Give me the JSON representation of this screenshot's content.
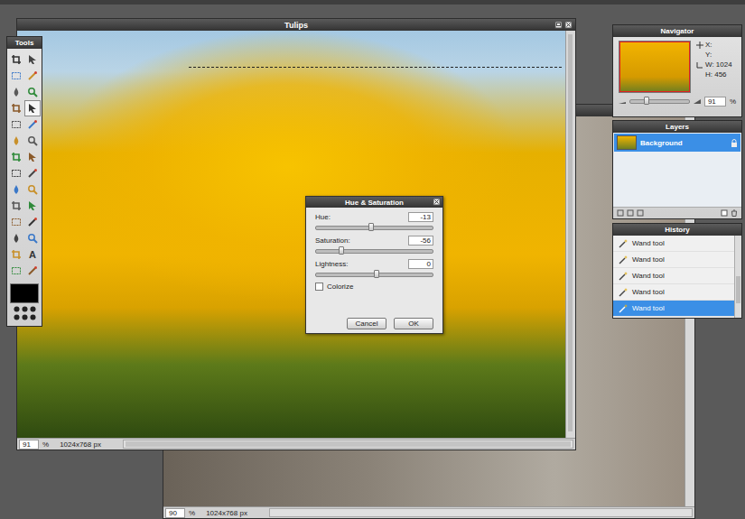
{
  "tulips_window": {
    "title": "Tulips",
    "zoom": "91",
    "zoom_unit": "%",
    "size": "1024x768 px"
  },
  "back_window": {
    "zoom": "90",
    "zoom_unit": "%",
    "size": "1024x768 px"
  },
  "tools": {
    "title": "Tools",
    "items": [
      {
        "kind": "icon",
        "label": "",
        "selected": false
      },
      {
        "kind": "icon",
        "label": "",
        "selected": false
      },
      {
        "kind": "icon",
        "label": "",
        "selected": false
      },
      {
        "kind": "icon",
        "label": "",
        "selected": false
      },
      {
        "kind": "icon",
        "label": "",
        "selected": false
      },
      {
        "kind": "icon",
        "label": "",
        "selected": false
      },
      {
        "kind": "icon",
        "label": "",
        "selected": false
      },
      {
        "kind": "icon",
        "label": "",
        "selected": true
      },
      {
        "kind": "icon",
        "label": "",
        "selected": false
      },
      {
        "kind": "icon",
        "label": "",
        "selected": false
      },
      {
        "kind": "icon",
        "label": "",
        "selected": false
      },
      {
        "kind": "icon",
        "label": "",
        "selected": false
      },
      {
        "kind": "icon",
        "label": "",
        "selected": false
      },
      {
        "kind": "icon",
        "label": "",
        "selected": false
      },
      {
        "kind": "icon",
        "label": "",
        "selected": false
      },
      {
        "kind": "icon",
        "label": "",
        "selected": false
      },
      {
        "kind": "icon",
        "label": "",
        "selected": false
      },
      {
        "kind": "icon",
        "label": "",
        "selected": false
      },
      {
        "kind": "icon",
        "label": "",
        "selected": false
      },
      {
        "kind": "icon",
        "label": "",
        "selected": false
      },
      {
        "kind": "icon",
        "label": "",
        "selected": false
      },
      {
        "kind": "icon",
        "label": "",
        "selected": false
      },
      {
        "kind": "icon",
        "label": "",
        "selected": false
      },
      {
        "kind": "icon",
        "label": "",
        "selected": false
      },
      {
        "kind": "icon",
        "label": "",
        "selected": false
      },
      {
        "kind": "glyph",
        "label": "A",
        "selected": false
      },
      {
        "kind": "icon",
        "label": "",
        "selected": false
      },
      {
        "kind": "icon",
        "label": "",
        "selected": false
      }
    ]
  },
  "dialog": {
    "title": "Hue & Saturation",
    "sliders": [
      {
        "label": "Hue:",
        "value": "-13",
        "level": 0.47
      },
      {
        "label": "Saturation:",
        "value": "-56",
        "level": 0.22
      },
      {
        "label": "Lightness:",
        "value": "0",
        "level": 0.52
      }
    ],
    "checkbox": {
      "label": "Colorize",
      "checked": false
    },
    "buttons": [
      "Cancel",
      "OK"
    ]
  },
  "navigator": {
    "title": "Navigator",
    "x_label": "X:",
    "y_label": "Y:",
    "w_label": "W:",
    "w_value": "1024",
    "h_label": "H:",
    "h_value": "456",
    "zoom": "91",
    "zoom_unit": "%",
    "zoom_level": 0.28
  },
  "layers": {
    "title": "Layers",
    "items": [
      {
        "name": "Background",
        "selected": true,
        "locked": true
      }
    ]
  },
  "history": {
    "title": "History",
    "items": [
      {
        "label": "Wand tool",
        "selected": false
      },
      {
        "label": "Wand tool",
        "selected": false
      },
      {
        "label": "Wand tool",
        "selected": false
      },
      {
        "label": "Wand tool",
        "selected": false
      },
      {
        "label": "Wand tool",
        "selected": true
      }
    ]
  }
}
